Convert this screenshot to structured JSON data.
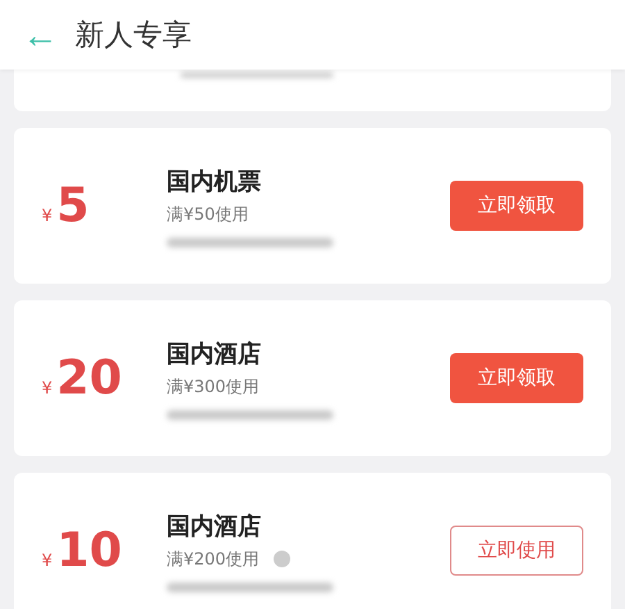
{
  "header": {
    "back_icon": "←",
    "title": "新人专享"
  },
  "coupons": [
    {
      "currency": "¥",
      "amount": "5",
      "title": "国内机票",
      "condition": "满¥50使用",
      "claimed": false,
      "info": false,
      "button": "立即领取"
    },
    {
      "currency": "¥",
      "amount": "20",
      "title": "国内酒店",
      "condition": "满¥300使用",
      "claimed": false,
      "info": false,
      "button": "立即领取"
    },
    {
      "currency": "¥",
      "amount": "10",
      "title": "国内酒店",
      "condition": "满¥200使用",
      "claimed": true,
      "info": true,
      "button": "立即使用"
    }
  ]
}
